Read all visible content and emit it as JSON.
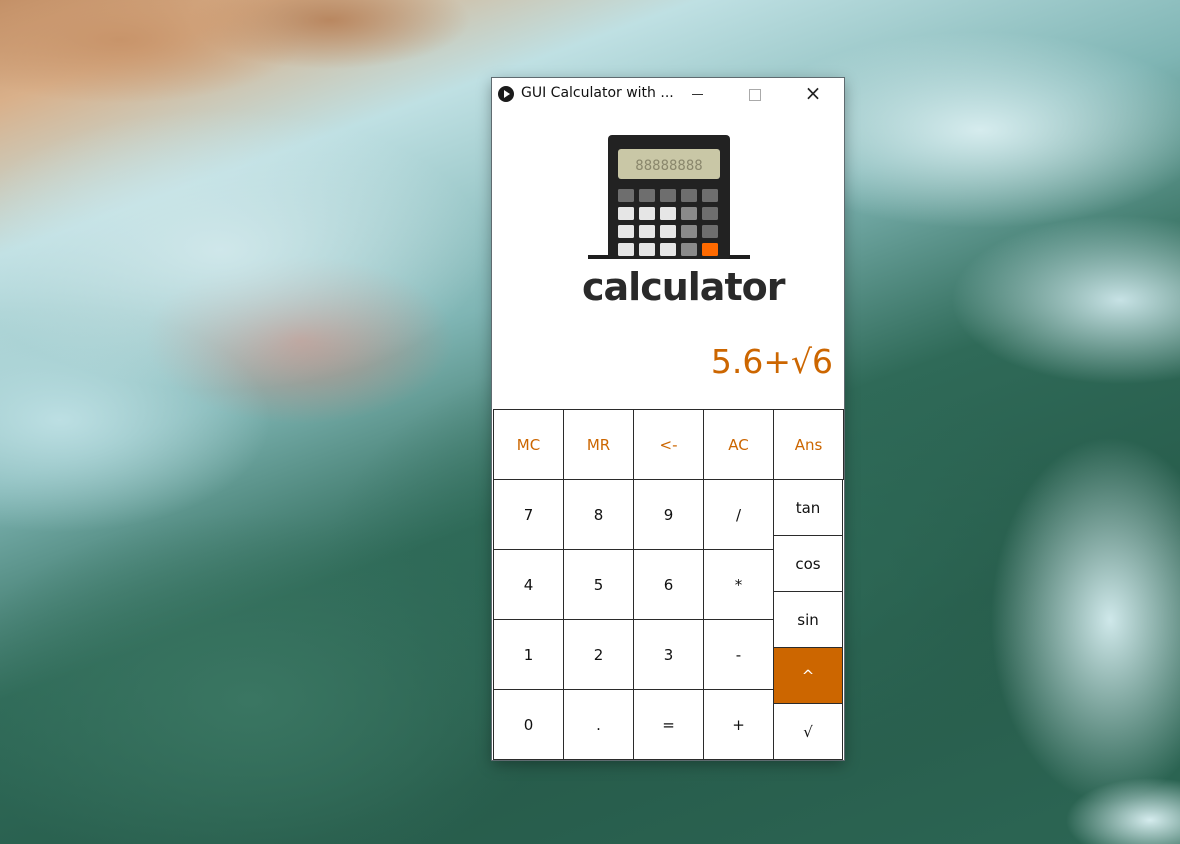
{
  "window": {
    "title": "GUI Calculator with ...",
    "close_label": "×"
  },
  "logo": {
    "text": "calculator",
    "lcd_text": "88888888"
  },
  "display": {
    "expression": "5.6+√6"
  },
  "colors": {
    "accent": "#cc6600",
    "border": "#2b2b2b"
  },
  "top_row": [
    {
      "id": "mc",
      "label": "MC"
    },
    {
      "id": "mr",
      "label": "MR"
    },
    {
      "id": "backspace",
      "label": "<-"
    },
    {
      "id": "ac",
      "label": "AC"
    },
    {
      "id": "ans",
      "label": "Ans"
    }
  ],
  "keypad": [
    {
      "id": "7",
      "label": "7"
    },
    {
      "id": "8",
      "label": "8"
    },
    {
      "id": "9",
      "label": "9"
    },
    {
      "id": "divide",
      "label": "/"
    },
    {
      "id": "4",
      "label": "4"
    },
    {
      "id": "5",
      "label": "5"
    },
    {
      "id": "6",
      "label": "6"
    },
    {
      "id": "multiply",
      "label": "*"
    },
    {
      "id": "1",
      "label": "1"
    },
    {
      "id": "2",
      "label": "2"
    },
    {
      "id": "3",
      "label": "3"
    },
    {
      "id": "minus",
      "label": "-"
    },
    {
      "id": "0",
      "label": "0"
    },
    {
      "id": "dot",
      "label": "."
    },
    {
      "id": "equals",
      "label": "="
    },
    {
      "id": "plus",
      "label": "+"
    }
  ],
  "functions": [
    {
      "id": "tan",
      "label": "tan"
    },
    {
      "id": "cos",
      "label": "cos"
    },
    {
      "id": "sin",
      "label": "sin"
    },
    {
      "id": "power",
      "label": "^"
    },
    {
      "id": "sqrt",
      "label": "√"
    }
  ]
}
